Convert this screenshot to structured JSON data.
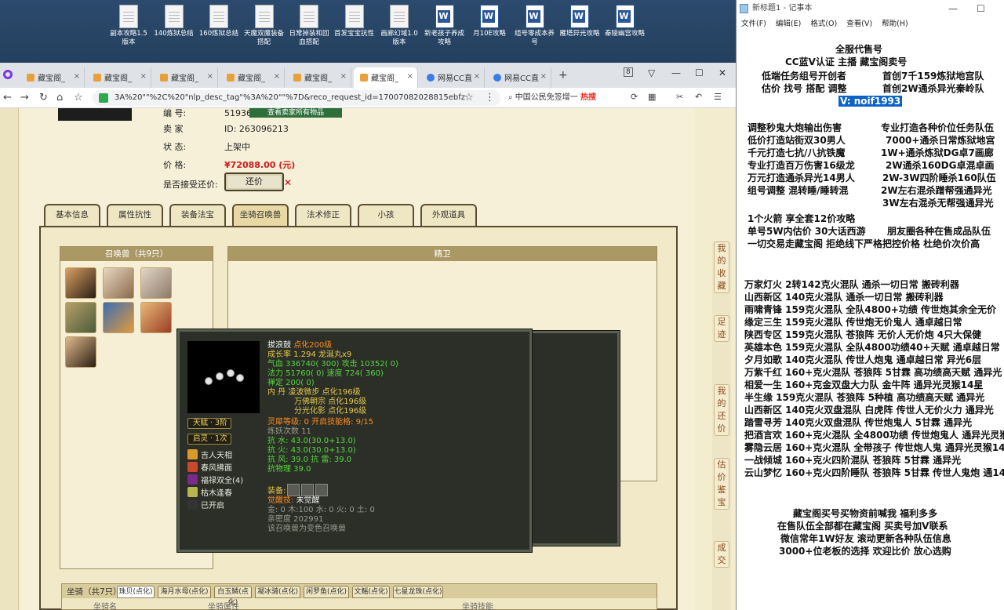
{
  "desktop": {
    "icons": [
      {
        "label": "副本攻略1.5版本",
        "type": "doc"
      },
      {
        "label": "140炼狱总结",
        "type": "doc"
      },
      {
        "label": "160炼狱总结",
        "type": "doc"
      },
      {
        "label": "天魔双魔装备搭配",
        "type": "doc"
      },
      {
        "label": "日常掉装和回血搭配",
        "type": "doc"
      },
      {
        "label": "首发宝宝抗性",
        "type": "doc"
      },
      {
        "label": "画廊幻域1.0版本",
        "type": "doc"
      },
      {
        "label": "新老孩子养成攻略",
        "type": "word"
      },
      {
        "label": "月10E攻略",
        "type": "word"
      },
      {
        "label": "组号零成本养号",
        "type": "word"
      },
      {
        "label": "雁塔异光攻略",
        "type": "word"
      },
      {
        "label": "秦陵幽宫攻略",
        "type": "word"
      }
    ]
  },
  "browser": {
    "tabs": [
      {
        "label": "藏宝阁_",
        "icon": "cbg",
        "active": false
      },
      {
        "label": "藏宝阁_",
        "icon": "cbg",
        "active": false
      },
      {
        "label": "藏宝阁_",
        "icon": "cbg",
        "active": false
      },
      {
        "label": "藏宝阁_",
        "icon": "cbg",
        "active": false
      },
      {
        "label": "藏宝阁_",
        "icon": "cbg",
        "active": false
      },
      {
        "label": "藏宝阁_",
        "icon": "cbg",
        "active": true
      },
      {
        "label": "网易CC直",
        "icon": "cc",
        "active": false
      },
      {
        "label": "网易CC直",
        "icon": "cc",
        "active": false
      }
    ],
    "tab_count": "8",
    "url": "3A%20\"\"%2C%20\"nlp_desc_tag\"%3A%20\"\"%7D&reco_request_id=17007082028815ebfz",
    "search_text": "中国公民免签增一",
    "search_hot": "热搜"
  },
  "listing": {
    "top_button": "查看卖家所有物品",
    "id_partial": "5193647",
    "seller_label": "卖    家",
    "seller_key": "ID:",
    "seller_id": "263096213",
    "status_label": "状        态:",
    "status_value": "上架中",
    "price_label": "价        格:",
    "price_value": "¥72088.00 (元)",
    "bargain_label": "是否接受还价:",
    "bargain_button": "还价"
  },
  "page_tabs": [
    "基本信息",
    "属性抗性",
    "装备法宝",
    "坐骑召唤兽",
    "法术修正",
    "小孩",
    "外观道具"
  ],
  "pets": {
    "title": "召唤兽（共9只）",
    "right_title": "精卫"
  },
  "tooltip": {
    "name": "拔浪鼓",
    "name_tag": "点化200级",
    "growth": "成长率 1.294  龙涎丸x9",
    "qixue": "气血 336740( 300)  攻击 10352( 0)",
    "fali": "法力 51760( 0)  速度 724( 360)",
    "chanding": "禅定 200( 0)",
    "nei": "内    丹  凌波微步 点化196级",
    "nei2": "万佛朝宗 点化196级",
    "nei3": "分光化影 点化196级",
    "lingxi": "灵犀等级:  0  开启技能格:  9/15",
    "lianyao": "炼妖次数 11",
    "kang_shui": "抗    水: 43.0(30.0+13.0)",
    "kang_huo": "抗    火: 43.0(30.0+13.0)",
    "kang_feng": "抗    风: 39.0  抗    雷: 39.0",
    "kang_wuli": "抗物理  39.0",
    "equip_label": "装备:",
    "juexing": "觉醒技:",
    "juexing_value": "未觉醒",
    "jin": "金: 0  木:100  水: 0  火: 0  土: 0",
    "qinmi": "亲密度  202991",
    "note": "该召唤兽为变色召唤兽",
    "tianfu": "天赋 · 3阶",
    "qisu": "启灵 · 1次",
    "skills": [
      "吉人天相",
      "春风拂面",
      "福禄双全(4)",
      "枯木逢春",
      "已开启"
    ]
  },
  "bottom": {
    "label": "坐骑（共7只）",
    "tabs": [
      "珠贝(点化)",
      "海月水母(点化)",
      "白玉鳞(点化)",
      "凝冰骑(点化)",
      "闲罗鱼(点化)",
      "文鳐(点化)",
      "七星龙珠(点化)"
    ],
    "col1": "坐骑名",
    "col2": "坐骑属性",
    "col3": "坐骑技能"
  },
  "right_side_chips": [
    "我的收藏",
    "足迹",
    "我的还价",
    "估价鉴宝",
    "成交"
  ],
  "notepad": {
    "title": "新标题1 - 记事本",
    "menu": [
      "文件(F)",
      "编辑(E)",
      "格式(O)",
      "查看(V)",
      "帮助(H)"
    ],
    "lines": [
      "全服代售号",
      "CC蓝V认证  主播  藏宝阁卖号",
      "低端任务组号开创者",
      "首创7千159炼狱地宫队",
      "估价 找号 搭配 调整",
      "首创2W通杀异光秦岭队",
      "V:  noif1993",
      "调整秒鬼大炮输出伤害",
      "专业打造各种价位任务队伍",
      "低价打造站街双30男人",
      "7000+通杀日常炼狱地宫",
      "千元打造七抗/八抗铁魔",
      "1W+通杀炼狱DG卓7画廊",
      "专业打造百万伤害16级龙",
      "2W通杀160DG卓混卓画",
      "万元打造通杀异光14男人",
      "2W-3W四阶睡杀160队伍",
      "组号调整 混转睡/睡转混",
      "2W左右混杀蹭帮强通异光",
      "3W左右混杀无帮强通异光",
      "1个火箭 享全套12价攻略",
      "单号5W内估价 30大话西游",
      "朋友圈各种在售成品队伍",
      "一切交易走藏宝阁 拒绝线下",
      "严格把控价格 杜绝价次价高",
      "万家灯火 2转142克火混队 通杀一切日常 搬砖利器",
      "山西新区 140克火混队 通杀一切日常 搬砖利器",
      "雨啸青锋 159克火混队 全队4800+功绩 传世炮其余全无价",
      "缘定三生 159克火混队 传世炮无价鬼人 通卓越日常",
      "陕西专区 159克火混队 苍狼阵 无价人无价炮 4只大保健",
      "英雄本色 159克火混队 全队4800功绩40+天赋 通卓越日常",
      "夕月如歌 140克火混队 传世人炮鬼 通卓越日常 异光6层",
      "万紫千红 160+克火混队 苍狼阵 5甘霖 高功绩高天赋 通异光",
      "相爱一生 160+克金双盘大力队 金牛阵 通异光灵猴14星",
      "半生缘     159克火混队 苍狼阵 5种植 高功绩高天赋 通异光",
      "山西新区 140克火双盘混队 白虎阵 传世人无价火力 通异光",
      "踏雪寻芳 140克火双盘混队 传世炮鬼人 5甘霖 通异光",
      "把酒言欢 160+克火混队 全4800功绩 传世炮鬼人 通异光灵猴",
      "雾隐云居 160+克火混队 全带孩子 传世炮人鬼 通异光灵猴14",
      "一战倾城 160+克火四阶混队 苍狼阵 5甘霖 通异光",
      "云山梦忆 160+克火四阶睡队 苍狼阵 5甘霖 传世人鬼炮 通14",
      "藏宝阁买号买物资前喊我 福利多多",
      "在售队伍全部都在藏宝阁 买卖号加V联系",
      "微信常年1W好友 滚动更新各种队伍信息",
      "3000+位老板的选择 欢迎比价 放心选购"
    ]
  }
}
